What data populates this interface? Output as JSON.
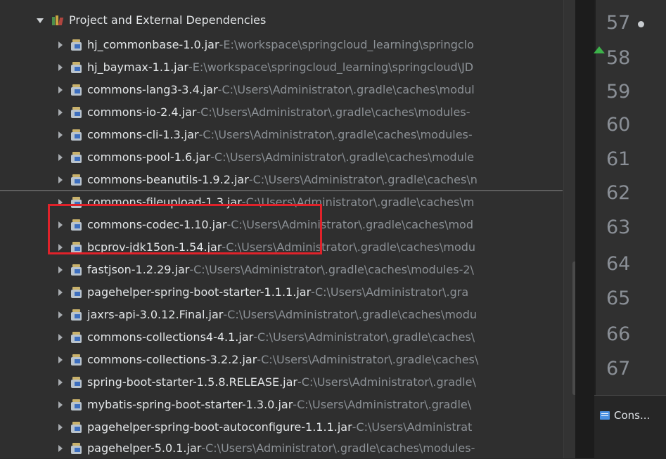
{
  "tree": {
    "root": {
      "label": "Project and External Dependencies"
    },
    "items": [
      {
        "name": "hj_commonbase-1.0.jar",
        "sep": " - ",
        "path": "E:\\workspace\\springcloud_learning\\springclo",
        "icon": "jar-icon"
      },
      {
        "name": "hj_baymax-1.1.jar",
        "sep": " - ",
        "path": "E:\\workspace\\springcloud_learning\\springcloud\\JD",
        "icon": "jar-icon"
      },
      {
        "name": "commons-lang3-3.4.jar",
        "sep": " - ",
        "path": "C:\\Users\\Administrator\\.gradle\\caches\\modul",
        "icon": "jar-icon"
      },
      {
        "name": "commons-io-2.4.jar",
        "sep": " - ",
        "path": "C:\\Users\\Administrator\\.gradle\\caches\\modules-",
        "icon": "jar-icon"
      },
      {
        "name": "commons-cli-1.3.jar",
        "sep": " - ",
        "path": "C:\\Users\\Administrator\\.gradle\\caches\\modules-",
        "icon": "jar-icon"
      },
      {
        "name": "commons-pool-1.6.jar",
        "sep": " - ",
        "path": "C:\\Users\\Administrator\\.gradle\\caches\\module",
        "icon": "jar-icon"
      },
      {
        "name": "commons-beanutils-1.9.2.jar",
        "sep": " - ",
        "path": "C:\\Users\\Administrator\\.gradle\\caches\\n",
        "icon": "jar-icon"
      },
      {
        "name": "commons-fileupload-1.3.jar",
        "sep": " - ",
        "path": "C:\\Users\\Administrator\\.gradle\\caches\\m",
        "icon": "jar-icon"
      },
      {
        "name": "commons-codec-1.10.jar",
        "sep": " - ",
        "path": "C:\\Users\\Administrator\\.gradle\\caches\\mod",
        "icon": "jar-icon"
      },
      {
        "name": "bcprov-jdk15on-1.54.jar",
        "sep": " - ",
        "path": "C:\\Users\\Administrator\\.gradle\\caches\\modu",
        "icon": "jar-icon"
      },
      {
        "name": "fastjson-1.2.29.jar",
        "sep": " - ",
        "path": "C:\\Users\\Administrator\\.gradle\\caches\\modules-2\\",
        "icon": "jar-icon"
      },
      {
        "name": "pagehelper-spring-boot-starter-1.1.1.jar",
        "sep": " - ",
        "path": "C:\\Users\\Administrator\\.gra",
        "icon": "jar-icon"
      },
      {
        "name": "jaxrs-api-3.0.12.Final.jar",
        "sep": " - ",
        "path": "C:\\Users\\Administrator\\.gradle\\caches\\modu",
        "icon": "jar-icon"
      },
      {
        "name": "commons-collections4-4.1.jar",
        "sep": " - ",
        "path": "C:\\Users\\Administrator\\.gradle\\caches\\",
        "icon": "jar-icon"
      },
      {
        "name": "commons-collections-3.2.2.jar",
        "sep": " - ",
        "path": "C:\\Users\\Administrator\\.gradle\\caches\\",
        "icon": "jar-icon"
      },
      {
        "name": "spring-boot-starter-1.5.8.RELEASE.jar",
        "sep": " - ",
        "path": "C:\\Users\\Administrator\\.gradle\\",
        "icon": "jar-icon"
      },
      {
        "name": "mybatis-spring-boot-starter-1.3.0.jar",
        "sep": " - ",
        "path": "C:\\Users\\Administrator\\.gradle\\",
        "icon": "jar-icon"
      },
      {
        "name": "pagehelper-spring-boot-autoconfigure-1.1.1.jar",
        "sep": " - ",
        "path": "C:\\Users\\Administrat",
        "icon": "jar-icon"
      },
      {
        "name": "pagehelper-5.0.1.jar",
        "sep": " - ",
        "path": "C:\\Users\\Administrator\\.gradle\\caches\\modules-",
        "icon": "jar-icon"
      }
    ]
  },
  "editor": {
    "line_numbers": [
      "57",
      "58",
      "59",
      "60",
      "61",
      "62",
      "63",
      "64",
      "65",
      "66",
      "67"
    ]
  },
  "console": {
    "tab_label": "Cons..."
  },
  "colors": {
    "highlight": "#e0222a",
    "fold_marker": "#3cb24a",
    "background": "#2f2f2f"
  }
}
